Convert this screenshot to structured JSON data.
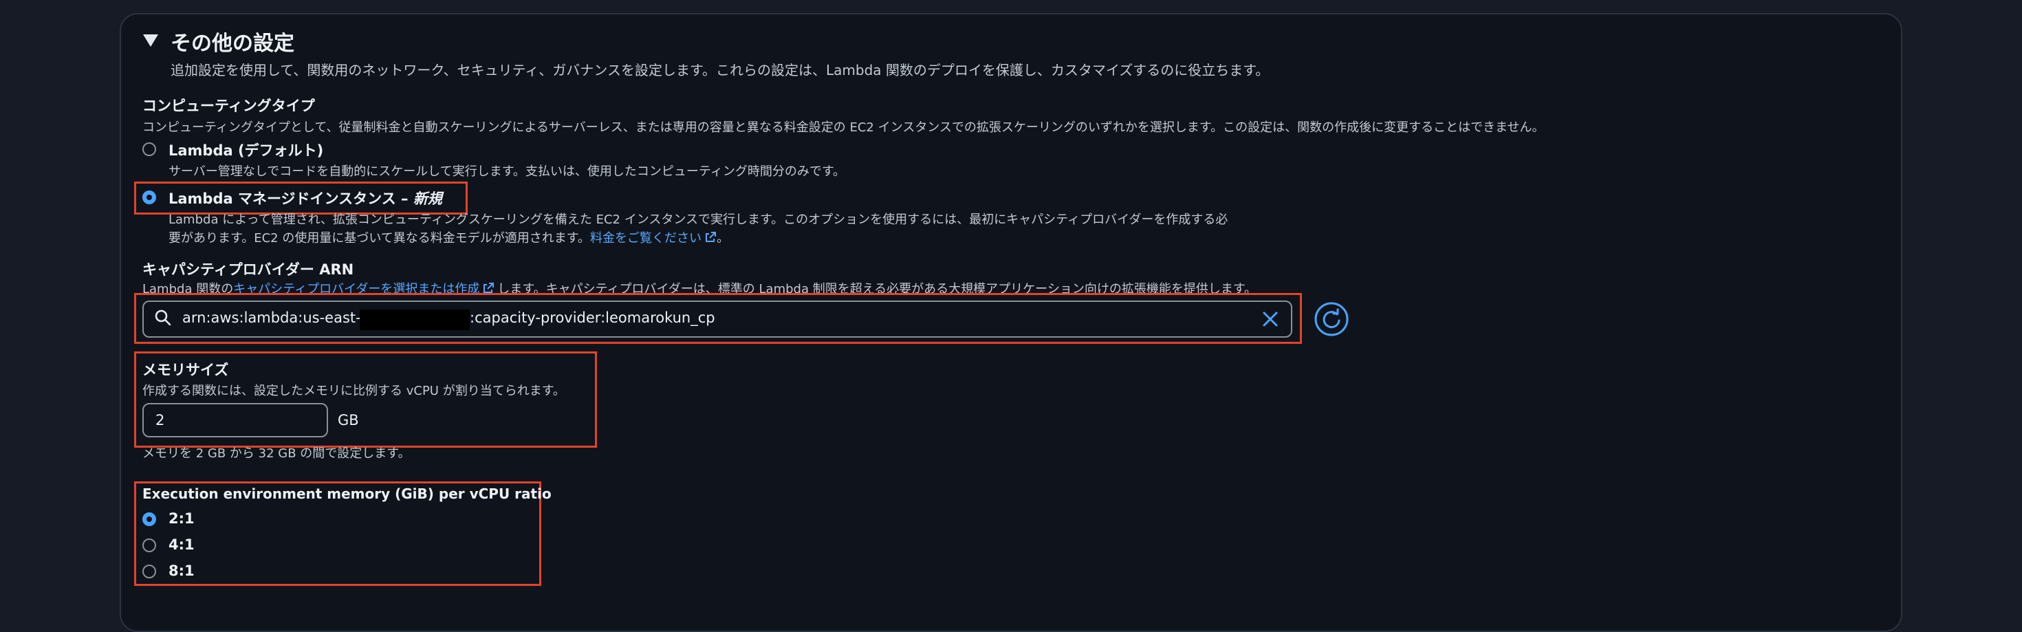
{
  "section": {
    "title": "その他の設定",
    "description": "追加設定を使用して、関数用のネットワーク、セキュリティ、ガバナンスを設定します。これらの設定は、Lambda 関数のデプロイを保護し、カスタマイズするのに役立ちます。"
  },
  "compute_type": {
    "label": "コンピューティングタイプ",
    "description": "コンピューティングタイプとして、従量制料金と自動スケーリングによるサーバーレス、または専用の容量と異なる料金設定の EC2 インスタンスでの拡張スケーリングのいずれかを選択します。この設定は、関数の作成後に変更することはできません。",
    "options": [
      {
        "label": "Lambda (デフォルト)",
        "description": "サーバー管理なしでコードを自動的にスケールして実行します。支払いは、使用したコンピューティング時間分のみです。",
        "selected": false
      },
      {
        "label": "Lambda マネージドインスタンス – ",
        "label_new": "新規",
        "description_line1": "Lambda によって管理され、拡張コンピューティングスケーリングを備えた EC2 インスタンスで実行します。このオプションを使用するには、最初にキャパシティプロバイダーを作成する必",
        "description_line2": "要があります。EC2 の使用量に基づいて異なる料金モデルが適用されます。",
        "pricing_link": "料金をご覧ください",
        "period": "。",
        "selected": true
      }
    ]
  },
  "capacity_provider": {
    "label": "キャパシティプロバイダー ARN",
    "desc_prefix": "Lambda 関数の",
    "desc_link": "キャパシティプロバイダーを選択または作成",
    "desc_suffix": "します。キャパシティプロバイダーは、標準の Lambda 制限を超える必要がある大規模アプリケーション向けの拡張機能を提供します。",
    "value_prefix": "arn:aws:lambda:us-east-1",
    "value_suffix": ":capacity-provider:leomarokun_cp"
  },
  "memory": {
    "label": "メモリサイズ",
    "description": "作成する関数には、設定したメモリに比例する vCPU が割り当てられます。",
    "value": "2",
    "unit": "GB",
    "hint": "メモリを 2 GB から 32 GB の間で設定します。"
  },
  "ratio": {
    "label": "Execution environment memory (GiB) per vCPU ratio",
    "options": [
      {
        "label": "2:1",
        "selected": true
      },
      {
        "label": "4:1",
        "selected": false
      },
      {
        "label": "8:1",
        "selected": false
      }
    ]
  },
  "colors": {
    "accent": "#4aa3ff",
    "highlight": "#e2432b",
    "link": "#57a7ff"
  }
}
